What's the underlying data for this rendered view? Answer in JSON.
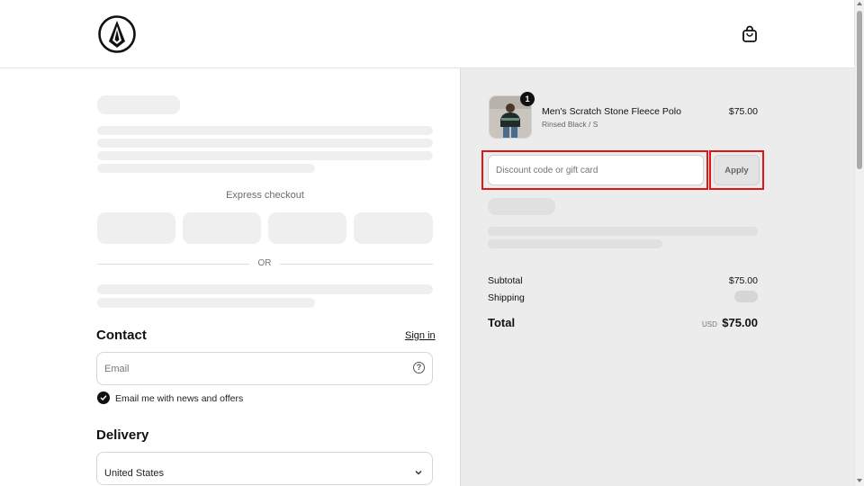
{
  "header": {
    "logo_icon": "volcom-stone-logo",
    "cart_icon": "shopping-bag-icon"
  },
  "checkout": {
    "express_label": "Express checkout",
    "divider_text": "OR",
    "contact": {
      "title": "Contact",
      "sign_in": "Sign in",
      "email_placeholder": "Email",
      "help_icon": "question-circle-icon",
      "newsletter_label": "Email me with news and offers",
      "newsletter_checked": true
    },
    "delivery": {
      "title": "Delivery",
      "country": "United States"
    }
  },
  "summary": {
    "item": {
      "name": "Men's Scratch Stone Fleece Polo",
      "variant": "Rinsed Black / S",
      "price": "$75.00",
      "quantity": "1"
    },
    "discount": {
      "placeholder": "Discount code or gift card",
      "apply_label": "Apply"
    },
    "subtotal_label": "Subtotal",
    "subtotal_value": "$75.00",
    "shipping_label": "Shipping",
    "total_label": "Total",
    "currency": "USD",
    "total_value": "$75.00"
  },
  "colors": {
    "highlight": "#e01515",
    "summary_bg": "#ececec",
    "skeleton": "#efefef"
  }
}
